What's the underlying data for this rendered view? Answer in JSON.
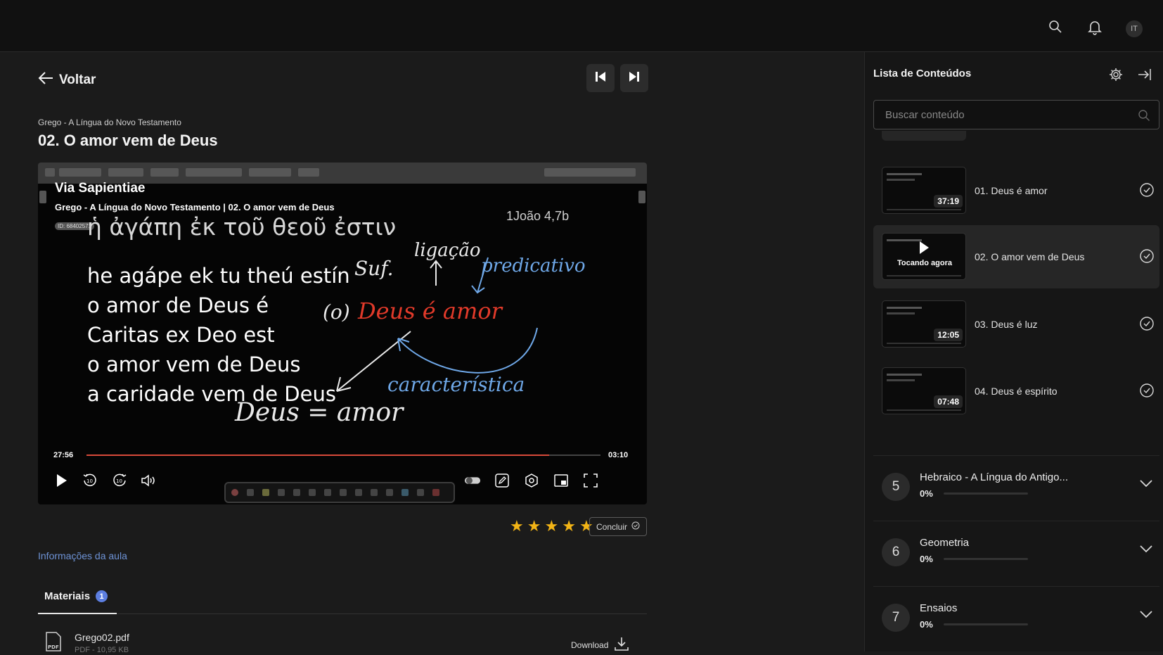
{
  "header": {
    "avatar_initials": "IT",
    "icons": [
      "search-icon",
      "bell-icon"
    ]
  },
  "nav": {
    "back_label": "Voltar",
    "prev_icon": "skip-previous-icon",
    "next_icon": "skip-next-icon"
  },
  "lesson": {
    "course": "Grego - A Língua do Novo Testamento",
    "title": "02. O amor vem de Deus"
  },
  "player": {
    "brand": "Via Sapientiae",
    "course_line": "Grego - A Língua do Novo Testamento | 02. O amor vem de Deus",
    "watermark_id": "ID: 68402571",
    "slide": {
      "reference": "1João 4,7b",
      "greek": "ἡ ἀγάπη ἐκ τοῦ θεοῦ ἐστιν",
      "lines": [
        "he agápe ek tu theú estín",
        "o amor de Deus é",
        "Caritas ex Deo est",
        "o amor vem de Deus",
        "a caridade vem de Deus"
      ],
      "handwriting": {
        "suf": "Suf.",
        "ligacao": "ligação",
        "predicativo": "predicativo",
        "o": "(o)",
        "deus_e_amor": "Deus é amor",
        "caracteristica": "característica",
        "deus_amor": "Deus = amor"
      }
    },
    "time_elapsed": "27:56",
    "time_remaining": "03:10",
    "progress": 0.9,
    "controls": [
      "play-icon",
      "rewind-10-icon",
      "forward-10-icon",
      "volume-icon",
      "autoplay-toggle-icon",
      "annotate-icon",
      "settings-icon",
      "pip-icon",
      "fullscreen-icon"
    ]
  },
  "rating": {
    "stars": 5,
    "max": 5,
    "color": "#f2b416"
  },
  "conclude_label": "Concluir",
  "info_link": "Informações da aula",
  "tabs": {
    "materials_label": "Materiais",
    "materials_count": "1"
  },
  "file": {
    "name": "Grego02.pdf",
    "meta": "PDF - 10,95 KB",
    "download_label": "Download",
    "icon": "pdf-icon"
  },
  "sidebar": {
    "title": "Lista de Conteúdos",
    "search_placeholder": "Buscar conteúdo",
    "now_playing_label": "Tocando agora",
    "items": [
      {
        "label": "01. Deus é amor",
        "duration": "37:19",
        "active": false
      },
      {
        "label": "02. O amor vem de Deus",
        "duration": "",
        "active": true
      },
      {
        "label": "03. Deus é luz",
        "duration": "12:05",
        "active": false
      },
      {
        "label": "04. Deus é espírito",
        "duration": "07:48",
        "active": false
      }
    ],
    "modules": [
      {
        "number": "5",
        "name": "Hebraico - A Língua do Antigo...",
        "percent": "0%"
      },
      {
        "number": "6",
        "name": "Geometria",
        "percent": "0%"
      },
      {
        "number": "7",
        "name": "Ensaios",
        "percent": "0%"
      }
    ]
  },
  "colors": {
    "accent": "#6e93d6",
    "progress": "#d84a3a",
    "red_ink": "#e23a2a",
    "blue_ink": "#6fa8e8",
    "badge": "#5c7ee0"
  }
}
